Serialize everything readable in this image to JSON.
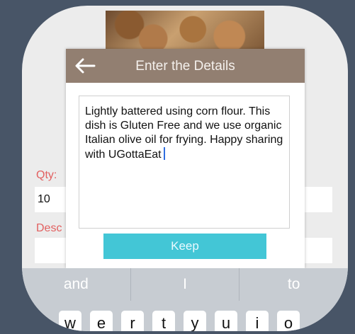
{
  "form": {
    "qty_label": "Qty:",
    "qty_value": "10",
    "desc_label": "Desc"
  },
  "dialog": {
    "title": "Enter the Details",
    "back_icon": "back-arrow-icon",
    "details_text": "Lightly battered using corn flour. This dish is Gluten Free and we use organic Italian olive oil for frying. Happy sharing with UGottaEat",
    "keep_label": "Keep",
    "keep_color": "#43c6d6",
    "header_color": "#927f71"
  },
  "keyboard": {
    "suggestions": [
      "and",
      "I",
      "to"
    ],
    "keys": [
      "w",
      "e",
      "r",
      "t",
      "y",
      "u",
      "i",
      "o"
    ]
  }
}
